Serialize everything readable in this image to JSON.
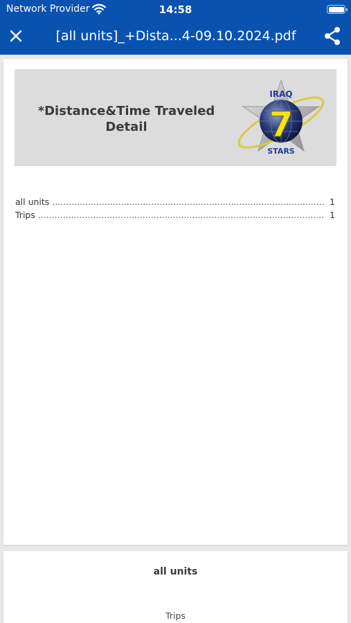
{
  "status_bar": {
    "carrier": "Network Provider",
    "time": "14:58"
  },
  "nav": {
    "title": "[all units]_+Dista...4-09.10.2024.pdf"
  },
  "page1": {
    "banner_title": "*Distance&Time Traveled Detail",
    "logo": {
      "top_text": "IRAQ",
      "numeral": "7",
      "bottom_text": "STARS"
    },
    "toc": [
      {
        "label": "all units",
        "page": "1"
      },
      {
        "label": "Trips",
        "page": "1"
      }
    ]
  },
  "page2": {
    "title": "all units",
    "subtitle": "Trips"
  },
  "colors": {
    "nav_bg": "#0a52b0",
    "banner_bg": "#dcdcdc",
    "page_bg": "#ffffff",
    "viewer_bg": "#e9e9eb"
  }
}
